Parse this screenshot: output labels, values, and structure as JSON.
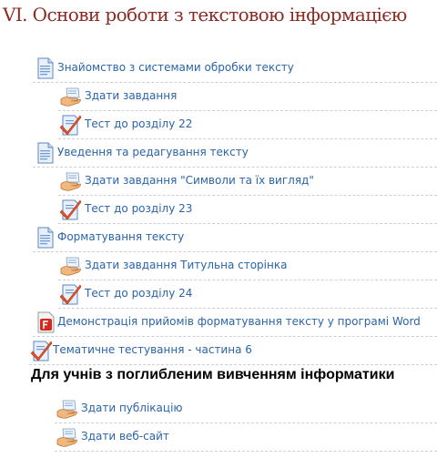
{
  "section_title": "VI. Основи роботи з текстовою інформацією",
  "advanced_heading": "Для учнів з поглибленим вивченням інформатики",
  "items": [
    {
      "icon": "document-page-icon",
      "label": "Знайомство з системами обробки тексту"
    },
    {
      "icon": "assignment-hand-icon",
      "label": "Здати завдання"
    },
    {
      "icon": "quiz-checkmark-icon",
      "label": "Тест до розділу 22"
    },
    {
      "icon": "document-page-icon",
      "label": "Уведення та редагування тексту"
    },
    {
      "icon": "assignment-hand-icon",
      "label": "Здати завдання \"Символи та їх вигляд\""
    },
    {
      "icon": "quiz-checkmark-icon",
      "label": "Тест до розділу 23"
    },
    {
      "icon": "document-page-icon",
      "label": "Форматування тексту"
    },
    {
      "icon": "assignment-hand-icon",
      "label": "Здати завдання Титульна сторінка"
    },
    {
      "icon": "quiz-checkmark-icon",
      "label": "Тест до розділу 24"
    },
    {
      "icon": "flash-presentation-icon",
      "label": "Демонстрація прийомів форматування тексту у програмі Word"
    },
    {
      "icon": "quiz-checkmark-icon",
      "label": "Тематичне тестування - частина 6"
    },
    {
      "icon": "assignment-hand-icon",
      "label": "Здати публікацію"
    },
    {
      "icon": "assignment-hand-icon",
      "label": "Здати веб-сайт"
    }
  ],
  "colors": {
    "title": "#8a2b22",
    "link": "#2a64a8",
    "divider": "#cfcfcf"
  }
}
